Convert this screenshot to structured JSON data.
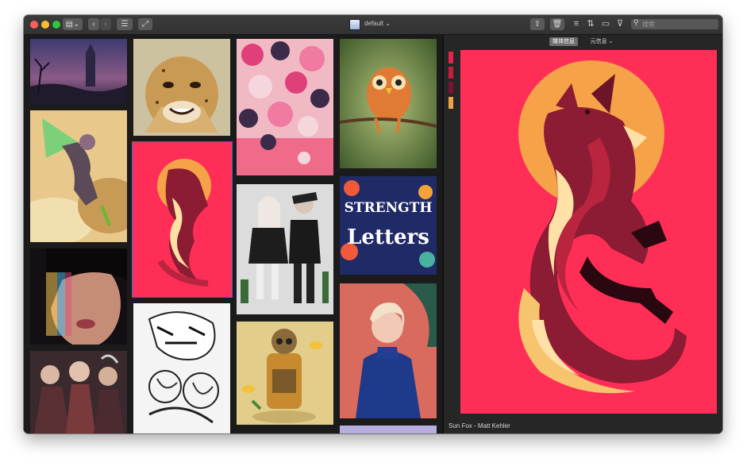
{
  "window": {
    "title": "default",
    "title_chevron": "⌄",
    "traffic_lights": [
      "#ff5f57",
      "#febc2e",
      "#28c840"
    ]
  },
  "toolbar": {
    "search_placeholder": "搜索",
    "search_icon": "magnifier-icon",
    "left_buttons": [
      "layout-toggle-icon",
      "back-icon",
      "forward-icon",
      "list-icon",
      "expand-icon"
    ],
    "right_buttons": [
      "share-icon",
      "trash-icon",
      "list-view-icon",
      "sort-icon",
      "display-icon",
      "filter-icon"
    ]
  },
  "gallery": {
    "selected_item": "Sun Fox - Matt Kehler"
  },
  "inspector": {
    "tabs": [
      {
        "label": "媒体信息",
        "active": true
      },
      {
        "label": "元信息",
        "active": false,
        "chevron": "⌄"
      }
    ],
    "palette": [
      "#e8244a",
      "#c71c3e",
      "#7a1330",
      "#f1a24a"
    ],
    "caption": "Sun Fox - Matt Kehler",
    "preview_colors": {
      "background": "#ff2e56",
      "sun": "#f5a249",
      "fox_dark": "#8b1c33",
      "fox_mid": "#b9243e",
      "fox_light": "#ffe0a6",
      "tail": "#f6c46d"
    }
  }
}
